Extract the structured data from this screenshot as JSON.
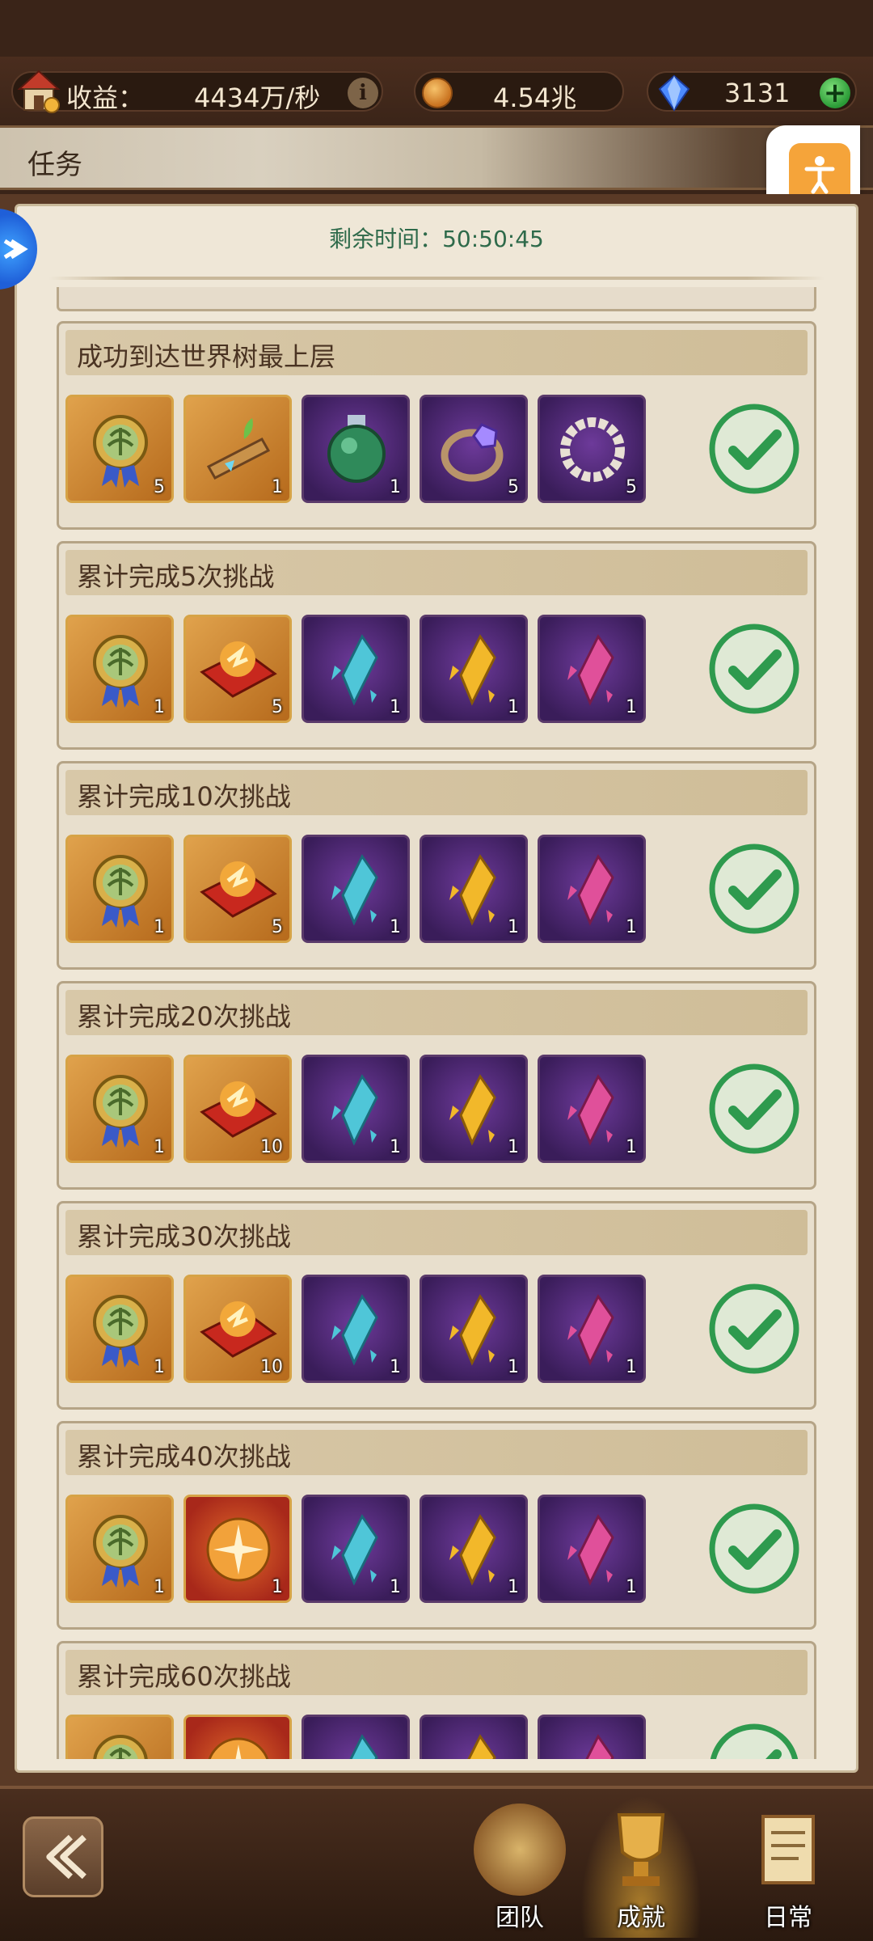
{
  "topbar": {
    "income_label": "收益：",
    "income_value": "4434万/秒",
    "info_label": "i",
    "gold_value": "4.54兆",
    "gem_value": "3131",
    "plus_label": "+"
  },
  "header": {
    "title": "任务"
  },
  "timer": {
    "text": "剩余时间：50:50:45"
  },
  "tasks": [
    {
      "title": "成功到达世界树最上层",
      "rewards": [
        {
          "icon": "medal-icon",
          "count": "5",
          "bg": "gold"
        },
        {
          "icon": "branch-icon",
          "count": "1",
          "bg": "gold"
        },
        {
          "icon": "potion-icon",
          "count": "1",
          "bg": "purple"
        },
        {
          "icon": "ring-icon",
          "count": "5",
          "bg": "purple"
        },
        {
          "icon": "pearl-necklace-icon",
          "count": "5",
          "bg": "purple"
        }
      ],
      "completed": true
    },
    {
      "title": "累计完成5次挑战",
      "rewards": [
        {
          "icon": "medal-icon",
          "count": "1",
          "bg": "gold"
        },
        {
          "icon": "red-ticket-icon",
          "count": "5",
          "bg": "gold"
        },
        {
          "icon": "blue-crystal-icon",
          "count": "1",
          "bg": "purple"
        },
        {
          "icon": "gold-crystal-icon",
          "count": "1",
          "bg": "purple"
        },
        {
          "icon": "pink-crystal-icon",
          "count": "1",
          "bg": "purple"
        }
      ],
      "completed": true
    },
    {
      "title": "累计完成10次挑战",
      "rewards": [
        {
          "icon": "medal-icon",
          "count": "1",
          "bg": "gold"
        },
        {
          "icon": "red-ticket-icon",
          "count": "5",
          "bg": "gold"
        },
        {
          "icon": "blue-crystal-icon",
          "count": "1",
          "bg": "purple"
        },
        {
          "icon": "gold-crystal-icon",
          "count": "1",
          "bg": "purple"
        },
        {
          "icon": "pink-crystal-icon",
          "count": "1",
          "bg": "purple"
        }
      ],
      "completed": true
    },
    {
      "title": "累计完成20次挑战",
      "rewards": [
        {
          "icon": "medal-icon",
          "count": "1",
          "bg": "gold"
        },
        {
          "icon": "red-ticket-icon",
          "count": "10",
          "bg": "gold"
        },
        {
          "icon": "blue-crystal-icon",
          "count": "1",
          "bg": "purple"
        },
        {
          "icon": "gold-crystal-icon",
          "count": "1",
          "bg": "purple"
        },
        {
          "icon": "pink-crystal-icon",
          "count": "1",
          "bg": "purple"
        }
      ],
      "completed": true
    },
    {
      "title": "累计完成30次挑战",
      "rewards": [
        {
          "icon": "medal-icon",
          "count": "1",
          "bg": "gold"
        },
        {
          "icon": "red-ticket-icon",
          "count": "10",
          "bg": "gold"
        },
        {
          "icon": "blue-crystal-icon",
          "count": "1",
          "bg": "purple"
        },
        {
          "icon": "gold-crystal-icon",
          "count": "1",
          "bg": "purple"
        },
        {
          "icon": "pink-crystal-icon",
          "count": "1",
          "bg": "purple"
        }
      ],
      "completed": true
    },
    {
      "title": "累计完成40次挑战",
      "rewards": [
        {
          "icon": "medal-icon",
          "count": "1",
          "bg": "gold"
        },
        {
          "icon": "orb-icon",
          "count": "1",
          "bg": "red"
        },
        {
          "icon": "blue-crystal-icon",
          "count": "1",
          "bg": "purple"
        },
        {
          "icon": "gold-crystal-icon",
          "count": "1",
          "bg": "purple"
        },
        {
          "icon": "pink-crystal-icon",
          "count": "1",
          "bg": "purple"
        }
      ],
      "completed": true
    },
    {
      "title": "累计完成60次挑战",
      "rewards": [
        {
          "icon": "medal-icon",
          "count": "",
          "bg": "gold"
        },
        {
          "icon": "orb-icon",
          "count": "",
          "bg": "red"
        },
        {
          "icon": "blue-crystal-icon",
          "count": "",
          "bg": "purple"
        },
        {
          "icon": "gold-crystal-icon",
          "count": "",
          "bg": "purple"
        },
        {
          "icon": "pink-crystal-icon",
          "count": "",
          "bg": "purple"
        }
      ],
      "completed": true
    }
  ],
  "bottom_nav": {
    "team": "团队",
    "achievement": "成就",
    "daily": "日常"
  },
  "colors": {
    "accent_green": "#2e9a4e",
    "timer_text": "#2e6a4a",
    "background_brown": "#3a2418"
  }
}
